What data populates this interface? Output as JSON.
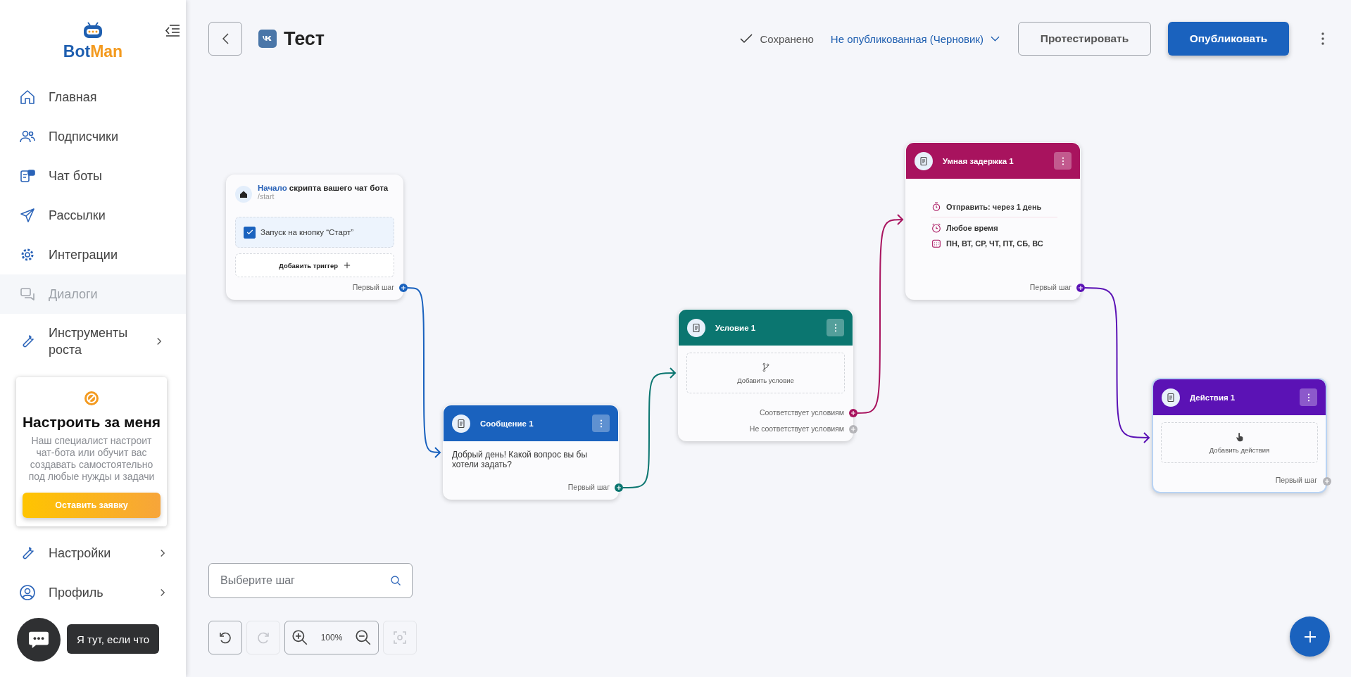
{
  "sidebar": {
    "logo": {
      "first": "Bot",
      "second": "Man"
    },
    "items": [
      {
        "label": "Главная",
        "disabled": false,
        "expandable": false
      },
      {
        "label": "Подписчики",
        "disabled": false,
        "expandable": false
      },
      {
        "label": "Чат боты",
        "disabled": false,
        "expandable": false
      },
      {
        "label": "Рассылки",
        "disabled": false,
        "expandable": false
      },
      {
        "label": "Интеграции",
        "disabled": false,
        "expandable": false
      },
      {
        "label": "Диалоги",
        "disabled": true,
        "expandable": false
      },
      {
        "label": "Инструменты роста",
        "disabled": false,
        "expandable": true
      }
    ],
    "promo": {
      "title": "Настроить за меня",
      "text": "Наш специалист настроит чат-бота или обучит вас создавать самостоятельно под любые нужды и задачи",
      "button": "Оставить заявку"
    },
    "bottom_items": [
      {
        "label": "Настройки",
        "disabled": false,
        "expandable": true
      },
      {
        "label": "Профиль",
        "disabled": false,
        "expandable": true
      }
    ]
  },
  "header": {
    "title": "Тест",
    "saved": "Сохранено",
    "status": "Не опубликованная (Черновик)",
    "buttons": [
      {
        "label": "Протестировать",
        "kind": "outline"
      },
      {
        "label": "Опубликовать",
        "kind": "primary"
      }
    ]
  },
  "nodes": [
    {
      "kind": "start",
      "selected": false,
      "title_link": "Начало",
      "title_rest": "скрипта вашего чат бота",
      "command": "/start",
      "trigger": {
        "label": "Запуск на кнопку “Старт”",
        "checked": true
      },
      "add_label": "Добавить триггер",
      "ports": [
        {
          "label": "Первый шаг",
          "connected": true
        }
      ]
    },
    {
      "kind": "message",
      "color": "#1a62be",
      "selected": false,
      "title": "Сообщение 1",
      "text": "Добрый день! Какой вопрос вы бы хотели задать?",
      "ports": [
        {
          "label": "Первый шаг",
          "connected": true
        }
      ]
    },
    {
      "kind": "condition",
      "color": "#0b7670",
      "selected": false,
      "title": "Условие 1",
      "add_label": "Добавить условие",
      "ports": [
        {
          "label": "Соответствует условиям",
          "connected": true
        },
        {
          "label": "Не соответствует условиям",
          "connected": false
        }
      ]
    },
    {
      "kind": "delay",
      "color": "#a8135e",
      "selected": false,
      "title": "Умная задержка 1",
      "rows": [
        {
          "kind": "timer",
          "text": "Отправить: через 1 день"
        },
        {
          "kind": "clock",
          "text": "Любое время"
        },
        {
          "kind": "calendar",
          "text": "ПН, ВТ, СР, ЧТ, ПТ, СБ, ВС"
        }
      ],
      "ports": [
        {
          "label": "Первый шаг",
          "connected": true
        }
      ]
    },
    {
      "kind": "action",
      "color": "#5b12b5",
      "selected": true,
      "title": "Действия 1",
      "add_label": "Добавить действия",
      "ports": [
        {
          "label": "Первый шаг",
          "connected": false
        }
      ]
    }
  ],
  "search": {
    "placeholder": "Выберите шаг"
  },
  "toolbar": {
    "buttons": [
      {
        "kind": "undo",
        "disabled": false
      },
      {
        "kind": "redo",
        "disabled": true
      },
      {
        "kind": "fit",
        "disabled": true
      }
    ],
    "zoom": "100%"
  },
  "chat": {
    "tooltip": "Я тут, если что"
  }
}
